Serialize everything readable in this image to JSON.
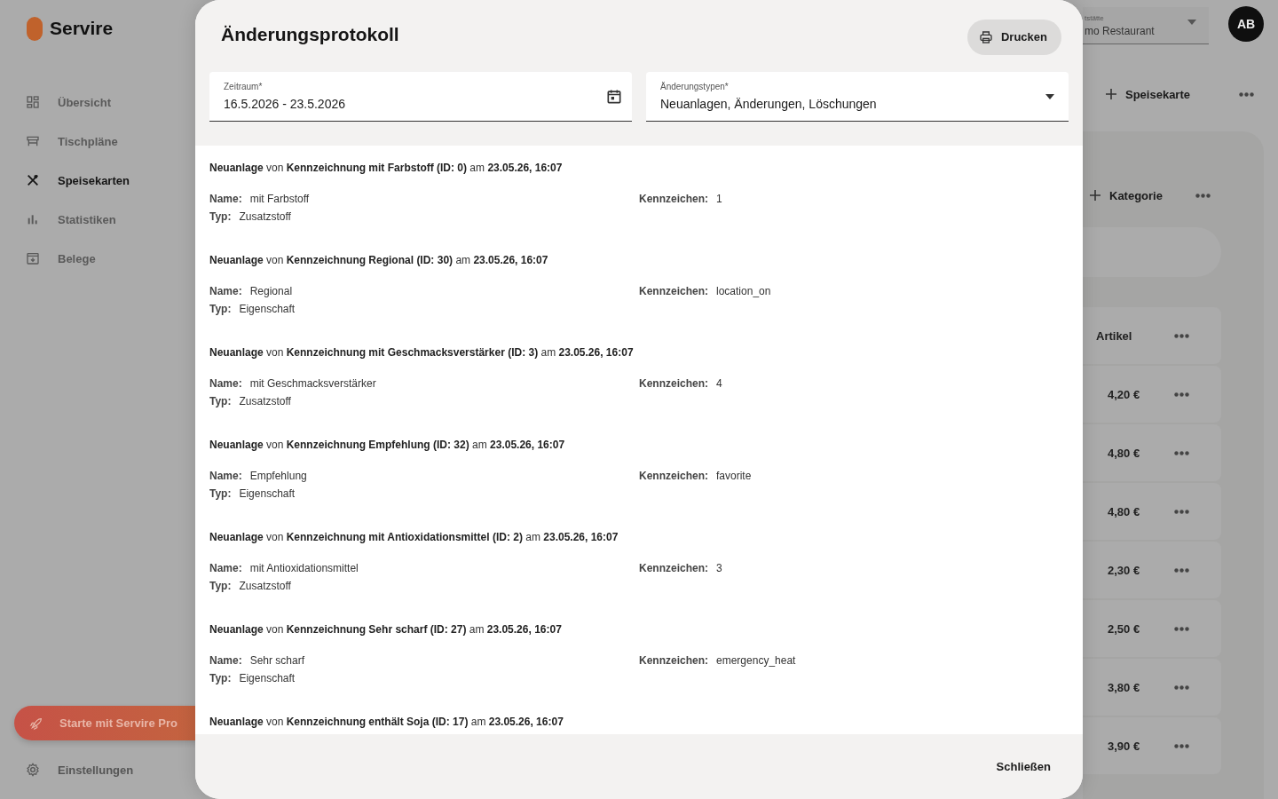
{
  "sidebar": {
    "brand": "Servire",
    "nav": [
      {
        "label": "Übersicht",
        "selected": false
      },
      {
        "label": "Tischpläne",
        "selected": false
      },
      {
        "label": "Speisekarten",
        "selected": true
      },
      {
        "label": "Statistiken",
        "selected": false
      },
      {
        "label": "Belege",
        "selected": false
      }
    ],
    "promo_button": "Starte mit Servire Pro",
    "settings": "Einstellungen"
  },
  "topbar": {
    "location_field": {
      "label": "tstätte",
      "value": "mo Restaurant"
    },
    "avatar": "AB"
  },
  "toolbar": {
    "add_button": "Speisekarte"
  },
  "category_panel": {
    "add_button": "Kategorie",
    "items_header": "Artikel",
    "prices": [
      "4,20 €",
      "4,80 €",
      "4,80 €",
      "2,30 €",
      "2,50 €",
      "3,80 €",
      "3,90 €"
    ]
  },
  "dialog": {
    "title": "Änderungsprotokoll",
    "print_button": "Drucken",
    "period_field": {
      "label": "Zeitraum*",
      "value": "16.5.2026 - 23.5.2026"
    },
    "types_field": {
      "label": "Änderungstypen*",
      "value": "Neuanlagen, Änderungen, Löschungen"
    },
    "entries": [
      {
        "heading": "**Neuanlage** von **Kennzeichnung mit Farbstoff (ID: 0)** am **23.05.26, 16:07**",
        "left_fields": [
          {
            "label": "Name:",
            "value": "mit Farbstoff"
          },
          {
            "label": "Typ:",
            "value": "Zusatzstoff"
          }
        ],
        "right_fields": [
          {
            "label": "Kennzeichen:",
            "value": "1"
          }
        ]
      },
      {
        "heading": "**Neuanlage** von **Kennzeichnung Regional (ID: 30)** am **23.05.26, 16:07**",
        "left_fields": [
          {
            "label": "Name:",
            "value": "Regional"
          },
          {
            "label": "Typ:",
            "value": "Eigenschaft"
          }
        ],
        "right_fields": [
          {
            "label": "Kennzeichen:",
            "value": "location_on"
          }
        ]
      },
      {
        "heading": "**Neuanlage** von **Kennzeichnung mit Geschmacksverstärker (ID: 3)** am **23.05.26, 16:07**",
        "left_fields": [
          {
            "label": "Name:",
            "value": "mit Geschmacksverstärker"
          },
          {
            "label": "Typ:",
            "value": "Zusatzstoff"
          }
        ],
        "right_fields": [
          {
            "label": "Kennzeichen:",
            "value": "4"
          }
        ]
      },
      {
        "heading": "**Neuanlage** von **Kennzeichnung Empfehlung (ID: 32)** am **23.05.26, 16:07**",
        "left_fields": [
          {
            "label": "Name:",
            "value": "Empfehlung"
          },
          {
            "label": "Typ:",
            "value": "Eigenschaft"
          }
        ],
        "right_fields": [
          {
            "label": "Kennzeichen:",
            "value": "favorite"
          }
        ]
      },
      {
        "heading": "**Neuanlage** von **Kennzeichnung mit Antioxidationsmittel (ID: 2)** am **23.05.26, 16:07**",
        "left_fields": [
          {
            "label": "Name:",
            "value": "mit Antioxidationsmittel"
          },
          {
            "label": "Typ:",
            "value": "Zusatzstoff"
          }
        ],
        "right_fields": [
          {
            "label": "Kennzeichen:",
            "value": "3"
          }
        ]
      },
      {
        "heading": "**Neuanlage** von **Kennzeichnung Sehr scharf (ID: 27)** am **23.05.26, 16:07**",
        "left_fields": [
          {
            "label": "Name:",
            "value": "Sehr scharf"
          },
          {
            "label": "Typ:",
            "value": "Eigenschaft"
          }
        ],
        "right_fields": [
          {
            "label": "Kennzeichen:",
            "value": "emergency_heat"
          }
        ]
      },
      {
        "heading": "**Neuanlage** von **Kennzeichnung enthält Soja (ID: 17)** am **23.05.26, 16:07**"
      }
    ],
    "close_button": "Schließen"
  }
}
